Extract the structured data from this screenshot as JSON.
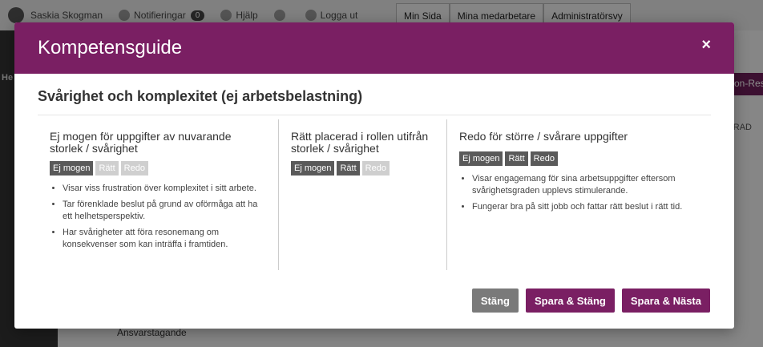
{
  "background": {
    "user_name": "Saskia Skogman",
    "notifications_label": "Notifieringar",
    "notifications_count": "0",
    "help_label": "Hjälp",
    "logout_label": "Logga ut",
    "tabs": [
      "Min Sida",
      "Mina medarbetare",
      "Administratörsvy"
    ],
    "sidebar_label": "He",
    "side_button_label": "on-Rest",
    "column_label": "RAD",
    "row_label": "Ansvarstagande"
  },
  "modal": {
    "title": "Kompetensguide",
    "close_symbol": "×",
    "section_title": "Svårighet och komplexitet (ej arbetsbelastning)",
    "tag_labels": [
      "Ej mogen",
      "Rätt",
      "Redo"
    ],
    "columns": [
      {
        "heading": "Ej mogen för uppgifter av nuvarande storlek / svårighet",
        "active_tag": 0,
        "bullets": [
          "Visar viss frustration över komplexitet i sitt arbete.",
          "Tar förenklade beslut på grund av oförmåga att ha ett helhetsperspektiv.",
          "Har svårigheter att föra resonemang om konsekvenser som kan inträffa i framtiden."
        ]
      },
      {
        "heading": "Rätt placerad i rollen utifrån storlek / svårighet",
        "active_tag": 1,
        "bullets": []
      },
      {
        "heading": "Redo för större / svårare uppgifter",
        "active_tag": 2,
        "bullets": [
          "Visar engagemang för sina arbetsuppgifter eftersom svårighetsgraden upplevs stimulerande.",
          "Fungerar bra på sitt jobb och fattar rätt beslut i rätt tid."
        ]
      }
    ],
    "buttons": {
      "close": "Stäng",
      "save_close": "Spara & Stäng",
      "save_next": "Spara & Nästa"
    }
  },
  "colors": {
    "brand": "#7a1f63",
    "button_gray": "#7a7a7a",
    "tag_active": "#5a5a5a",
    "tag_dim": "#cfcfcf"
  }
}
